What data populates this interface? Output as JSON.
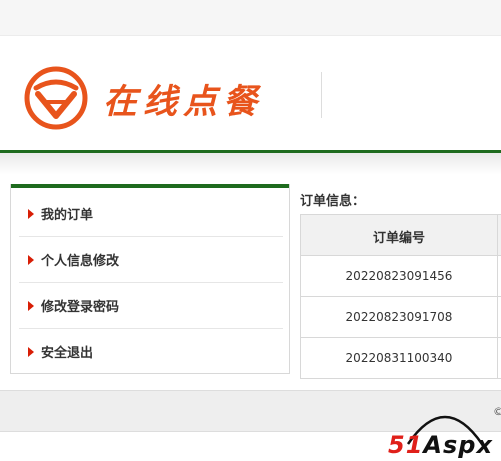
{
  "header": {
    "logo_text": "在线点餐"
  },
  "sidebar": {
    "items": [
      {
        "label": "我的订单"
      },
      {
        "label": "个人信息修改"
      },
      {
        "label": "修改登录密码"
      },
      {
        "label": "安全退出"
      }
    ]
  },
  "content": {
    "title": "订单信息：",
    "table": {
      "columns": [
        "订单编号"
      ],
      "rows": [
        [
          "20220823091456"
        ],
        [
          "20220823091708"
        ],
        [
          "20220831100340"
        ]
      ]
    }
  },
  "footer": {
    "copyright_fragment": "©"
  },
  "watermark": {
    "text_red": "51",
    "text_dark": "Aspx"
  },
  "colors": {
    "brand_orange": "#e8541c",
    "accent_green": "#1e6b1e",
    "menu_arrow": "#d81e06"
  },
  "icons": {
    "logo": "restaurant-logo-icon",
    "menu_arrow": "triangle-right-icon"
  }
}
